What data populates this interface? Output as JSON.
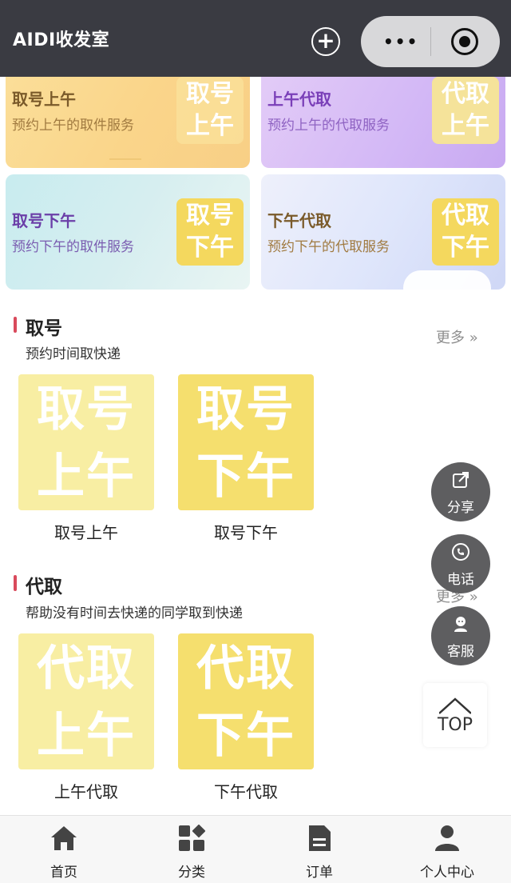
{
  "header": {
    "title": "AIDI收发室",
    "more_dots": "•••"
  },
  "banners": [
    {
      "title": "取号上午",
      "subtitle": "预约上午的取件服务",
      "badge_line1": "取号",
      "badge_line2": "上午",
      "title_color": "#7a5a2a",
      "sub_color": "#a07a40",
      "badge_color": "#f9df92"
    },
    {
      "title": "上午代取",
      "subtitle": "预约上午的代取服务",
      "badge_line1": "代取",
      "badge_line2": "上午",
      "title_color": "#7a3fb8",
      "sub_color": "#8e62c2",
      "badge_color": "#f5e39a"
    },
    {
      "title": "取号下午",
      "subtitle": "预约下午的取件服务",
      "badge_line1": "取号",
      "badge_line2": "下午",
      "title_color": "#6b3fa8",
      "sub_color": "#7a5cb0",
      "badge_color": "#f4d85e"
    },
    {
      "title": "下午代取",
      "subtitle": "预约下午的代取服务",
      "badge_line1": "代取",
      "badge_line2": "下午",
      "title_color": "#7a5a2a",
      "sub_color": "#a07a40",
      "badge_color": "#f4d85e"
    }
  ],
  "sections": [
    {
      "title": "取号",
      "subtitle": "预约时间取快递",
      "more": "更多 »",
      "items": [
        {
          "line1": "取号",
          "line2": "上午",
          "label": "取号上午"
        },
        {
          "line1": "取号",
          "line2": "下午",
          "label": "取号下午"
        }
      ]
    },
    {
      "title": "代取",
      "subtitle": "帮助没有时间去快递的同学取到快递",
      "more": "更多 »",
      "items": [
        {
          "line1": "代取",
          "line2": "上午",
          "label": "上午代取"
        },
        {
          "line1": "代取",
          "line2": "下午",
          "label": "下午代取"
        }
      ]
    }
  ],
  "floating": {
    "share": {
      "label": "分享",
      "icon": "share-icon"
    },
    "phone": {
      "label": "电话",
      "icon": "phone-icon"
    },
    "service": {
      "label": "客服",
      "icon": "customer-service-icon"
    },
    "top": {
      "label": "TOP",
      "icon": "chevron-up-icon"
    }
  },
  "tabs": [
    {
      "label": "首页",
      "icon": "home-icon"
    },
    {
      "label": "分类",
      "icon": "category-icon"
    },
    {
      "label": "订单",
      "icon": "order-icon"
    },
    {
      "label": "个人中心",
      "icon": "user-icon"
    }
  ],
  "colors": {
    "accent_red": "#d94a5c",
    "tile_light": "#f8eea3",
    "tile_strong": "#f5df6e",
    "header_bg": "#3a3b42"
  }
}
